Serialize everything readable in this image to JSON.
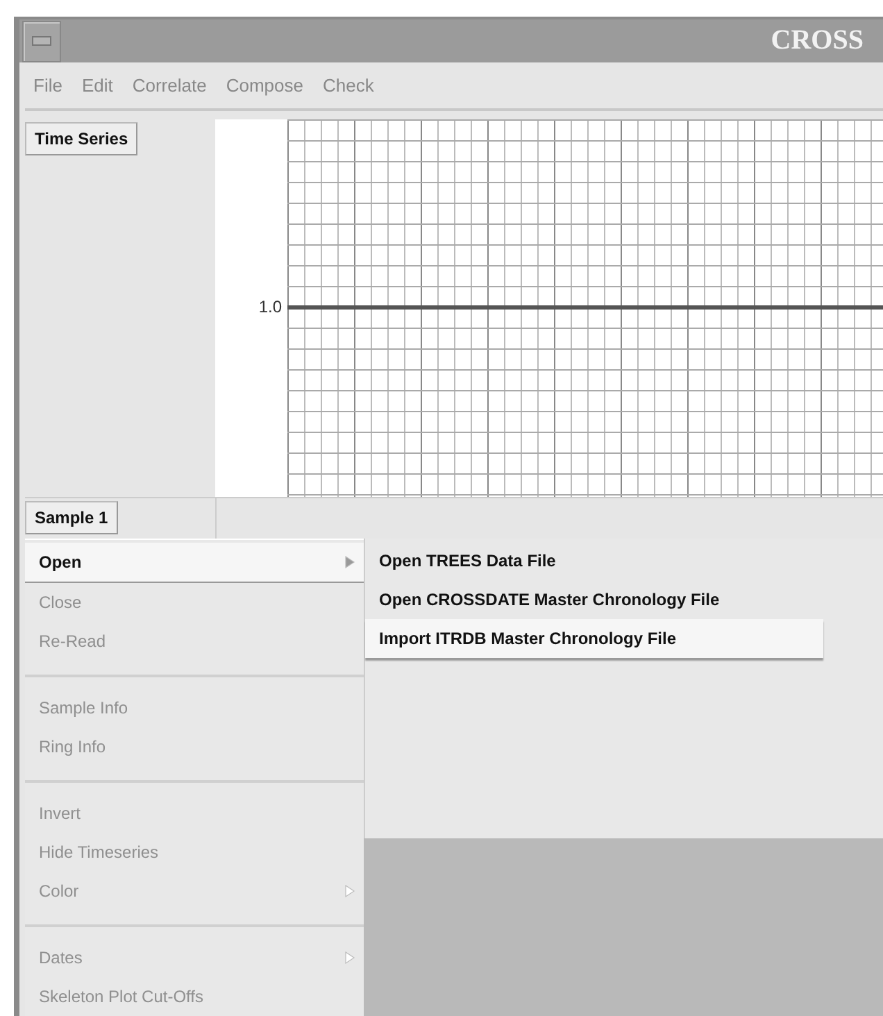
{
  "window": {
    "title": "CROSS"
  },
  "menu_bar": [
    "File",
    "Edit",
    "Correlate",
    "Compose",
    "Check"
  ],
  "panel_button": "Time Series",
  "plot": {
    "y_label": "1.0"
  },
  "sample_button": "Sample 1",
  "context_menu": [
    {
      "kind": "item",
      "label": "Open",
      "disabled": false,
      "selected": true,
      "submenu": true
    },
    {
      "kind": "item",
      "label": "Close",
      "disabled": true,
      "selected": false,
      "submenu": false
    },
    {
      "kind": "item",
      "label": "Re-Read",
      "disabled": true,
      "selected": false,
      "submenu": false
    },
    {
      "kind": "separator"
    },
    {
      "kind": "item",
      "label": "Sample Info",
      "disabled": true,
      "selected": false,
      "submenu": false
    },
    {
      "kind": "item",
      "label": "Ring Info",
      "disabled": true,
      "selected": false,
      "submenu": false
    },
    {
      "kind": "separator"
    },
    {
      "kind": "item",
      "label": "Invert",
      "disabled": true,
      "selected": false,
      "submenu": false
    },
    {
      "kind": "item",
      "label": "Hide Timeseries",
      "disabled": true,
      "selected": false,
      "submenu": false
    },
    {
      "kind": "item",
      "label": "Color",
      "disabled": true,
      "selected": false,
      "submenu": true
    },
    {
      "kind": "separator"
    },
    {
      "kind": "item",
      "label": "Dates",
      "disabled": true,
      "selected": false,
      "submenu": true
    },
    {
      "kind": "item",
      "label": "Skeleton Plot Cut-Offs",
      "disabled": true,
      "selected": false,
      "submenu": false
    }
  ],
  "submenu": [
    {
      "label": "Open TREES Data File",
      "selected": false
    },
    {
      "label": "Open CROSSDATE Master Chronology File",
      "selected": false
    },
    {
      "label": "Import ITRDB Master Chronology File",
      "selected": true
    }
  ]
}
